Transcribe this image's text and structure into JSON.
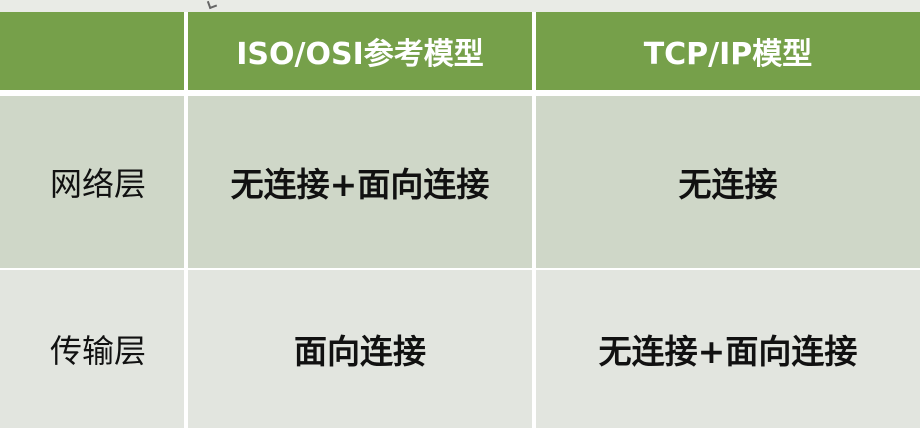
{
  "table": {
    "header": [
      "",
      "ISO/OSI参考模型",
      "TCP/IP模型"
    ],
    "rows": [
      {
        "label": "网络层",
        "iso_osi": "无连接+面向连接",
        "tcp_ip": "无连接"
      },
      {
        "label": "传输层",
        "iso_osi": "面向连接",
        "tcp_ip": "无连接+面向连接"
      }
    ]
  },
  "colors": {
    "header_bg": "#76a04a",
    "row1_bg": "#cfd7c8",
    "row2_bg": "#e2e5df",
    "header_text": "#ffffff",
    "body_text": "#111111"
  },
  "icons": {
    "cursor": "mouse-cursor-icon"
  }
}
